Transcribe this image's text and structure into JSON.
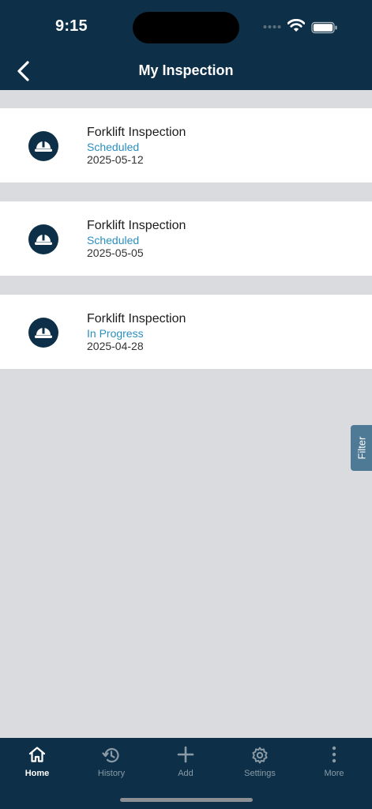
{
  "status_bar": {
    "time": "9:15"
  },
  "header": {
    "title": "My Inspection"
  },
  "inspections": [
    {
      "title": "Forklift Inspection",
      "status": "Scheduled",
      "date": "2025-05-12",
      "icon": "hard-hat-icon"
    },
    {
      "title": "Forklift Inspection",
      "status": "Scheduled",
      "date": "2025-05-05",
      "icon": "hard-hat-icon"
    },
    {
      "title": "Forklift Inspection",
      "status": "In Progress",
      "date": "2025-04-28",
      "icon": "hard-hat-icon"
    }
  ],
  "filter": {
    "label": "Filter"
  },
  "tabbar": {
    "items": [
      {
        "label": "Home",
        "icon": "home-icon",
        "active": true
      },
      {
        "label": "History",
        "icon": "history-icon",
        "active": false
      },
      {
        "label": "Add",
        "icon": "plus-icon",
        "active": false
      },
      {
        "label": "Settings",
        "icon": "gear-icon",
        "active": false
      },
      {
        "label": "More",
        "icon": "more-vertical-icon",
        "active": false
      }
    ]
  },
  "colors": {
    "header": "#0d3048",
    "status_accent": "#2a8fbf",
    "background": "#dadbdf",
    "filter_tab": "#4f7a96"
  }
}
